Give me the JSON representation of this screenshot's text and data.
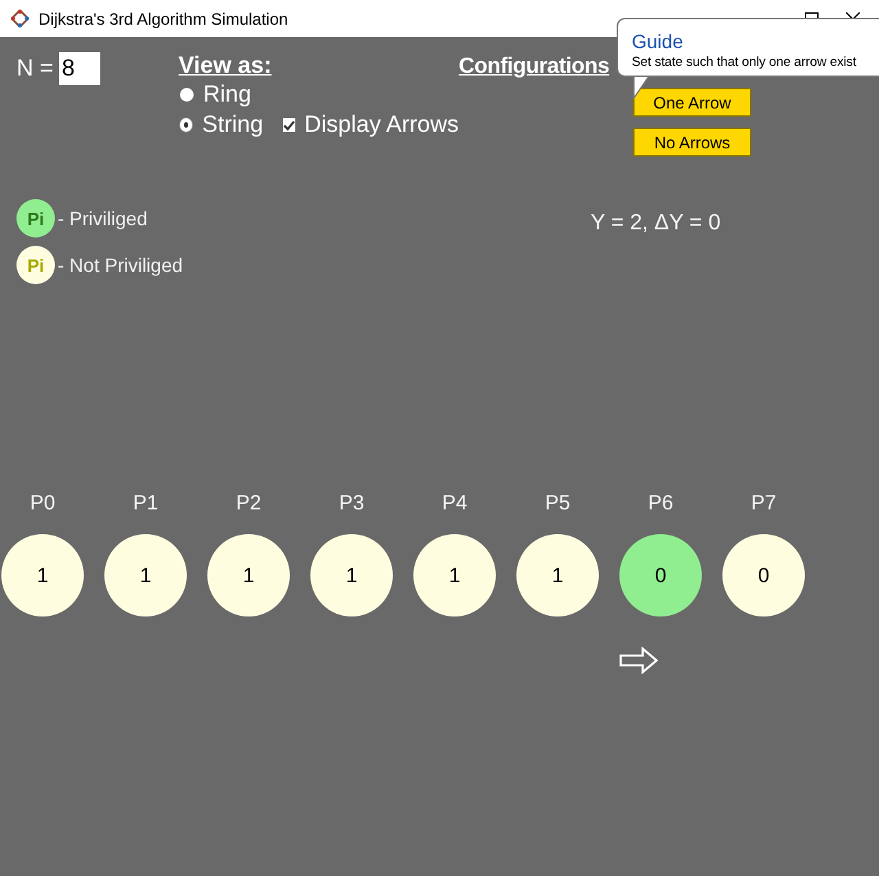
{
  "window": {
    "title": "Dijkstra's 3rd Algorithm Simulation"
  },
  "n_field": {
    "label": "N =",
    "value": "8"
  },
  "view_as": {
    "heading": "View as:",
    "options": [
      {
        "label": "Ring",
        "selected": false
      },
      {
        "label": "String",
        "selected": true
      }
    ]
  },
  "display_arrows": {
    "label": "Display Arrows",
    "checked": true
  },
  "configurations": {
    "heading": "Configurations",
    "buttons": [
      "One Arrow",
      "No Arrows"
    ]
  },
  "tooltip": {
    "title": "Guide",
    "text": "Set state such that only one arrow exist"
  },
  "legend": [
    {
      "badge": "Pi",
      "label": "- Priviliged",
      "privileged": true
    },
    {
      "badge": "Pi",
      "label": "- Not Priviliged",
      "privileged": false
    }
  ],
  "status": "Y = 2, ΔY = 0",
  "processes": [
    {
      "label": "P0",
      "value": "1",
      "privileged": false,
      "arrow": false
    },
    {
      "label": "P1",
      "value": "1",
      "privileged": false,
      "arrow": false
    },
    {
      "label": "P2",
      "value": "1",
      "privileged": false,
      "arrow": false
    },
    {
      "label": "P3",
      "value": "1",
      "privileged": false,
      "arrow": false
    },
    {
      "label": "P4",
      "value": "1",
      "privileged": false,
      "arrow": false
    },
    {
      "label": "P5",
      "value": "1",
      "privileged": false,
      "arrow": false
    },
    {
      "label": "P6",
      "value": "0",
      "privileged": true,
      "arrow": true
    },
    {
      "label": "P7",
      "value": "0",
      "privileged": false,
      "arrow": false
    }
  ]
}
